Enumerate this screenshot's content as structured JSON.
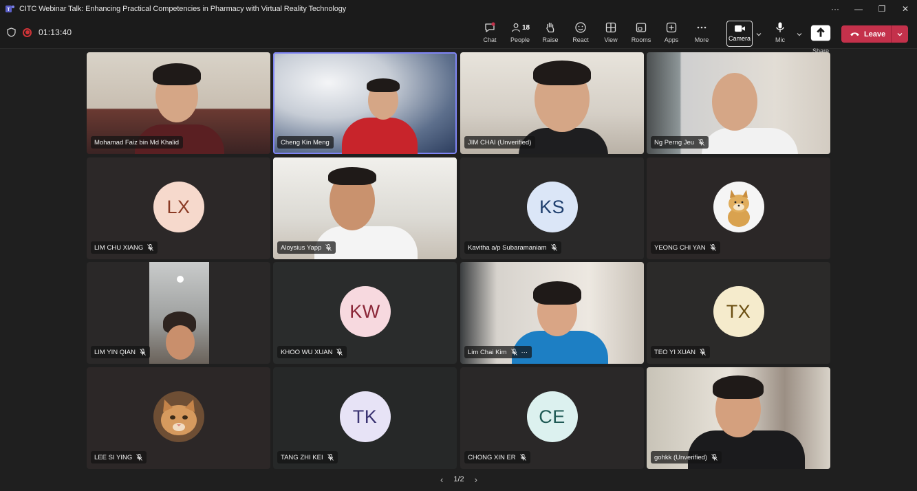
{
  "window": {
    "title": "CITC Webinar Talk: Enhancing Practical Competencies in Pharmacy with Virtual Reality Technology",
    "more": "···",
    "minimize": "—",
    "restore": "❐",
    "close": "✕"
  },
  "toolbar": {
    "timer": "01:13:40",
    "chat": "Chat",
    "people": "People",
    "people_count": "18",
    "raise": "Raise",
    "react": "React",
    "view": "View",
    "rooms": "Rooms",
    "apps": "Apps",
    "more": "More",
    "camera": "Camera",
    "mic": "Mic",
    "share": "Share",
    "leave": "Leave"
  },
  "tiles": [
    {
      "name": "Mohamad Faiz bin Md Khalid",
      "muted": false
    },
    {
      "name": "Cheng Kin Meng",
      "muted": false,
      "active": true
    },
    {
      "name": "JIM CHAI (Unverified)",
      "muted": false
    },
    {
      "name": "Ng Perng Jeu",
      "muted": true
    },
    {
      "name": "LIM CHU XIANG",
      "muted": true,
      "initials": "LX",
      "color": "#f6d9cc",
      "textColor": "#8a3a24"
    },
    {
      "name": "Aloysius Yapp",
      "muted": true
    },
    {
      "name": "Kavitha a/p Subaramaniam",
      "muted": true,
      "initials": "KS",
      "color": "#dbe6f7",
      "textColor": "#1f3f6e"
    },
    {
      "name": "YEONG CHI YAN",
      "muted": true
    },
    {
      "name": "LIM YIN QIAN",
      "muted": true
    },
    {
      "name": "KHOO WU XUAN",
      "muted": true,
      "initials": "KW",
      "color": "#f7d9df",
      "textColor": "#8a2637"
    },
    {
      "name": "Lim Chai Kim",
      "muted": true,
      "extra": "···"
    },
    {
      "name": "TEO YI XUAN",
      "muted": true,
      "initials": "TX",
      "color": "#f5ebcc",
      "textColor": "#6b4f12"
    },
    {
      "name": "LEE SI YING",
      "muted": true
    },
    {
      "name": "TANG ZHI KEI",
      "muted": true,
      "initials": "TK",
      "color": "#e7e3f6",
      "textColor": "#3b3472"
    },
    {
      "name": "CHONG XIN ER",
      "muted": true,
      "initials": "CE",
      "color": "#dcf1ef",
      "textColor": "#1f5a55"
    },
    {
      "name": "gohkk (Unverified)",
      "muted": true
    }
  ],
  "pager": {
    "label": "1/2"
  }
}
